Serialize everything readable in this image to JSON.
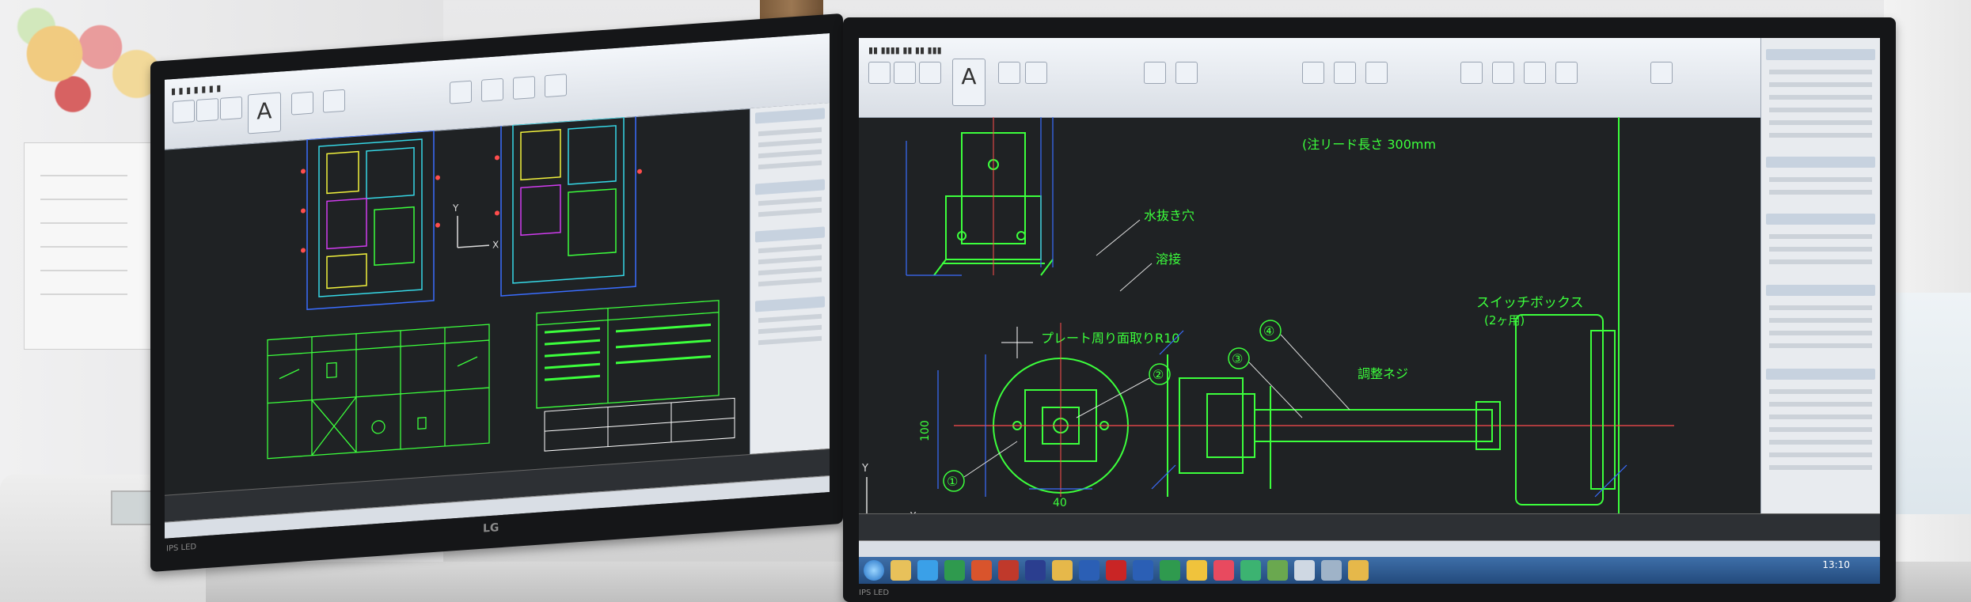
{
  "scene": {
    "left_brand": "LG",
    "left_model": "IPS LED",
    "right_model": "IPS LED"
  },
  "cad": {
    "note_text": "(注リード長さ  300mm",
    "labels": {
      "drain_hole": "水抜き穴",
      "weld": "溶接",
      "plate_chamfer": "プレート周り面取りR10",
      "adjust_screw": "調整ネジ",
      "switch_box": "スイッチボックス",
      "switch_box_note": "(2ヶ用)"
    },
    "circle_numbers": [
      "①",
      "②",
      "③",
      "④"
    ],
    "dim_100": "100",
    "dim_40": "40",
    "axis_y": "Y",
    "axis_x": "X"
  },
  "left_cad": {
    "axis_y": "Y",
    "axis_x": "X"
  },
  "taskbar": {
    "time": "13:10"
  },
  "colors": {
    "cad_bg": "#1f2224",
    "green": "#3cff3c",
    "cyan": "#36d8e6",
    "magenta": "#d13cf0",
    "yellow": "#f2f23d",
    "red": "#ff4d4d",
    "blue": "#3a6dff"
  }
}
